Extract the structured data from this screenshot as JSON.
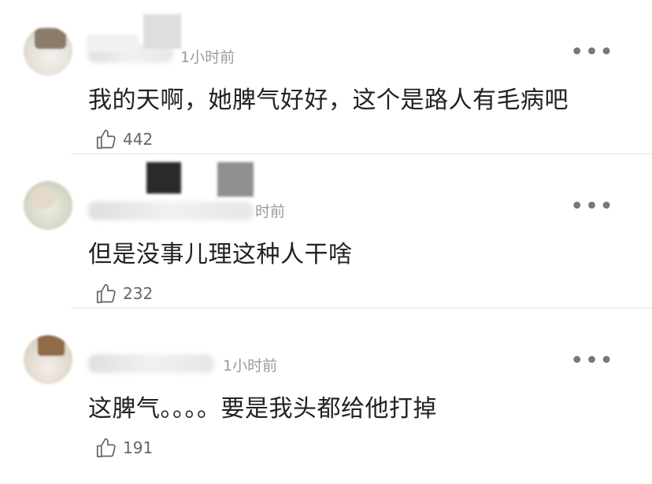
{
  "comments": [
    {
      "time": "1小时前",
      "text": "我的天啊，她脾气好好，这个是路人有毛病吧",
      "likes": "442",
      "more_icon": "more-dots-icon"
    },
    {
      "time": "时前",
      "text": "但是没事儿理这种人干啥",
      "likes": "232",
      "more_icon": "more-dots-icon"
    },
    {
      "time": "1小时前",
      "text": "这脾气。。。。要是我头都给他打掉",
      "likes": "191",
      "more_icon": "more-dots-icon"
    }
  ],
  "icons": {
    "like": "thumbs-up-icon",
    "more": "more-dots-icon"
  },
  "colors": {
    "text": "#222222",
    "meta": "#9b9b9b",
    "icon": "#666666",
    "divider": "#e6e6e6",
    "background": "#ffffff"
  }
}
